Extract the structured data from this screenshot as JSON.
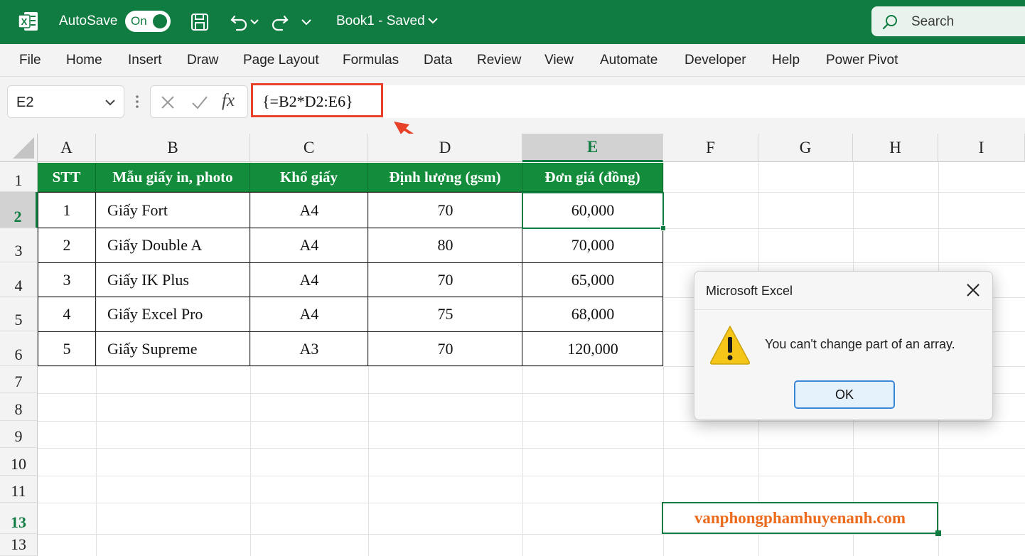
{
  "titlebar": {
    "autosave_label": "AutoSave",
    "autosave_state": "On",
    "doc_title": "Book1 - Saved",
    "search_placeholder": "Search"
  },
  "ribbon": {
    "tabs": [
      "File",
      "Home",
      "Insert",
      "Draw",
      "Page Layout",
      "Formulas",
      "Data",
      "Review",
      "View",
      "Automate",
      "Developer",
      "Help",
      "Power Pivot"
    ]
  },
  "formula_bar": {
    "name_box": "E2",
    "fx_label": "fx",
    "formula": "{=B2*D2:E6}"
  },
  "grid": {
    "columns": [
      "A",
      "B",
      "C",
      "D",
      "E",
      "F",
      "G",
      "H",
      "I"
    ],
    "selected_column": "E",
    "rows": [
      "1",
      "2",
      "3",
      "4",
      "5",
      "6",
      "7",
      "8",
      "9",
      "10",
      "11",
      "13",
      "13"
    ],
    "selected_row": "2"
  },
  "table": {
    "headers": [
      "STT",
      "Mẫu giấy in, photo",
      "Khổ giấy",
      "Định lượng (gsm)",
      "Đơn giá (đồng)"
    ],
    "rows": [
      [
        "1",
        "Giấy Fort",
        "A4",
        "70",
        "60,000"
      ],
      [
        "2",
        "Giấy Double A",
        "A4",
        "80",
        "70,000"
      ],
      [
        "3",
        "Giấy IK Plus",
        "A4",
        "70",
        "65,000"
      ],
      [
        "4",
        "Giấy Excel Pro",
        "A4",
        "75",
        "68,000"
      ],
      [
        "5",
        "Giấy Supreme",
        "A3",
        "70",
        "120,000"
      ]
    ]
  },
  "watermark": "vanphongphamhuyenanh.com",
  "dialog": {
    "title": "Microsoft Excel",
    "message": "You can't change part of an array.",
    "ok_label": "OK"
  },
  "colors": {
    "excel_green": "#107c41",
    "header_green": "#138c3c",
    "highlight_red": "#e8412a",
    "watermark_orange": "#ec6b1c"
  }
}
